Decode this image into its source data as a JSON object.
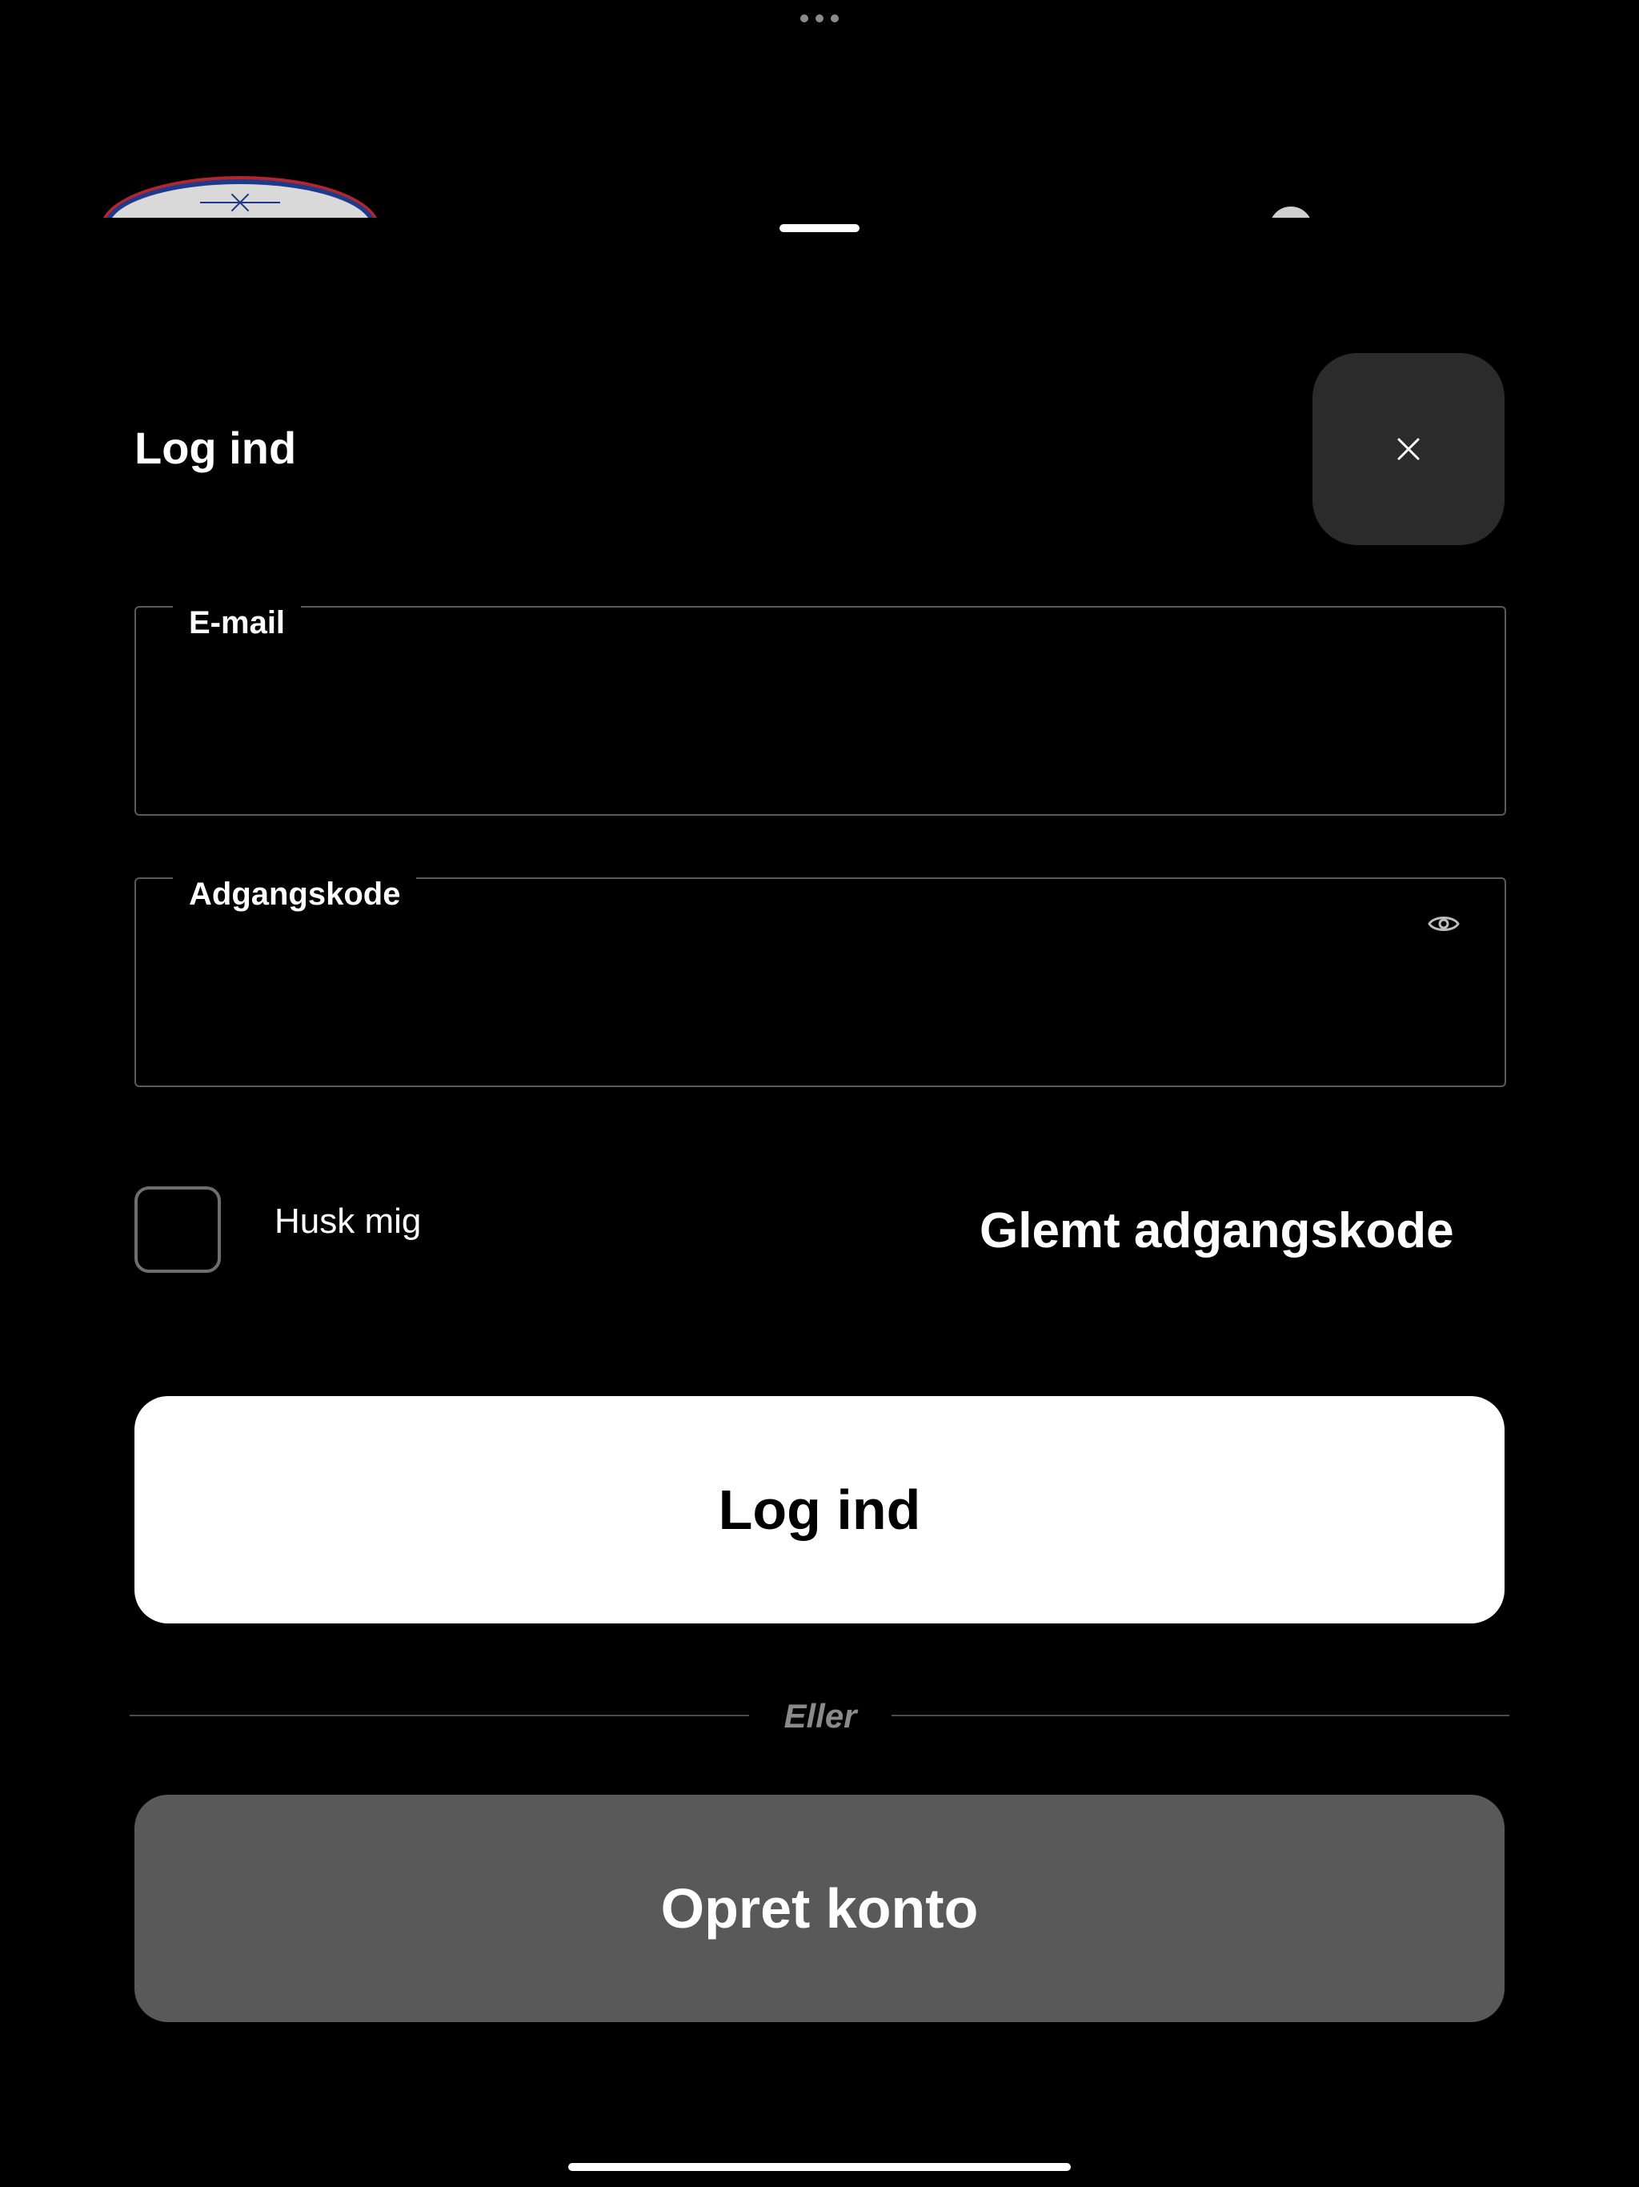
{
  "header": {
    "title": "Log ind",
    "close_icon": "close-icon"
  },
  "form": {
    "email": {
      "label": "E-mail",
      "value": "",
      "placeholder": ""
    },
    "password": {
      "label": "Adgangskode",
      "value": "",
      "placeholder": "",
      "toggle_icon": "eye-icon"
    },
    "remember_me": {
      "label": "Husk mig",
      "checked": false
    },
    "forgot_password": "Glemt adgangskode"
  },
  "actions": {
    "login_label": "Log ind",
    "divider_text": "Eller",
    "create_account_label": "Opret konto"
  },
  "colors": {
    "background": "#000000",
    "primary_button": "#ffffff",
    "secondary_button": "#595959",
    "close_button": "#2b2b2b",
    "divider": "#4a4a4a",
    "muted_text": "#8a8a8a"
  }
}
